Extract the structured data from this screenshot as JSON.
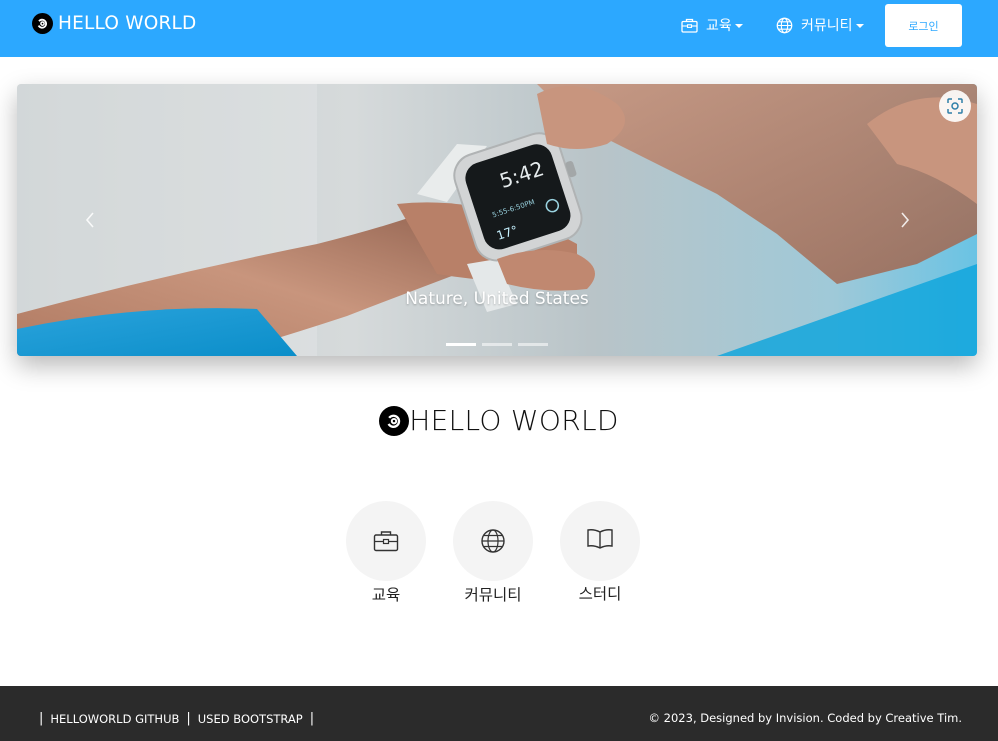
{
  "colors": {
    "primary": "#2ca8ff",
    "footer": "#2b2b2b",
    "feature_bg": "#f4f4f4"
  },
  "navbar": {
    "brand": "HELLO WORLD",
    "brand_icon": "hello-world-logo-icon",
    "items": [
      {
        "label": "교육",
        "icon": "briefcase-icon"
      },
      {
        "label": "커뮤니티",
        "icon": "globe-icon"
      }
    ],
    "login_label": "로그인"
  },
  "carousel": {
    "caption": "Nature, United States",
    "slide_count": 3,
    "active_index": 0
  },
  "hero": {
    "title": "HELLO WORLD"
  },
  "features": [
    {
      "label": "교육",
      "icon": "briefcase-icon"
    },
    {
      "label": "커뮤니티",
      "icon": "globe-icon"
    },
    {
      "label": "스터디",
      "icon": "book-icon"
    }
  ],
  "footer": {
    "links": [
      "HELLOWORLD GITHUB",
      "USED BOOTSTRAP"
    ],
    "separator": "|",
    "copyright": "© 2023, Designed by Invision. Coded by Creative Tim."
  }
}
